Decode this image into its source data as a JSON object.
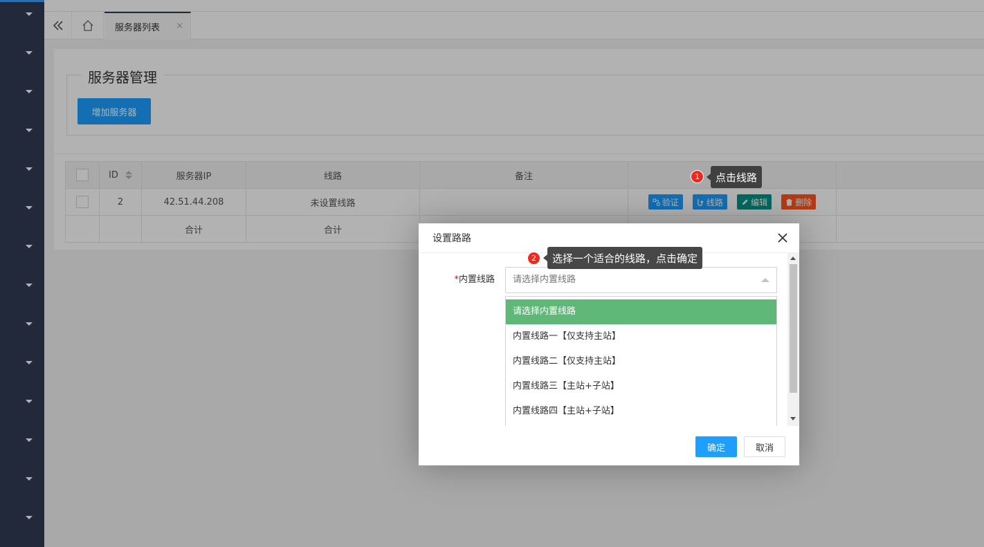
{
  "tabs": {
    "active_tab_label": "服务器列表",
    "close_glyph": "×"
  },
  "panel": {
    "legend": "服务器管理",
    "add_button": "增加服务器"
  },
  "table": {
    "columns": [
      "ID",
      "服务器IP",
      "线路",
      "备注"
    ],
    "row": {
      "id": "2",
      "ip": "42.51.44.208",
      "route": "未设置线路",
      "note": ""
    },
    "actions": {
      "verify": "验证",
      "route": "线路",
      "edit": "编辑",
      "delete": "删除"
    },
    "total_row": {
      "ip": "合计",
      "route": "合计"
    }
  },
  "tips": {
    "tip1_num": "1",
    "tip1_text": "点击线路",
    "tip2_num": "2",
    "tip2_text": "选择一个适合的线路，点击确定"
  },
  "dialog": {
    "title": "设置路路",
    "field_required_mark": "*",
    "field_label": "内置线路",
    "select_placeholder": "请选择内置线路",
    "options": [
      "请选择内置线路",
      "内置线路一【仅支持主站】",
      "内置线路二【仅支持主站】",
      "内置线路三【主站+子站】",
      "内置线路四【主站+子站】"
    ],
    "ok_button": "确定",
    "cancel_button": "取消"
  },
  "colors": {
    "sidebar": "#323c55",
    "primary": "#1e9fff",
    "verify": "#1e9fff",
    "route": "#1e9fff",
    "edit": "#009688",
    "delete": "#ff5722",
    "selected_option": "#5fb878",
    "badge": "#f0291e"
  },
  "icons": {
    "collapse": "double-chevron-left-icon",
    "home": "home-icon",
    "close": "close-icon",
    "verify": "link-check-icon",
    "route": "route-icon",
    "edit": "pencil-icon",
    "delete": "trash-icon",
    "sidebar_expand": "caret-down-icon"
  }
}
